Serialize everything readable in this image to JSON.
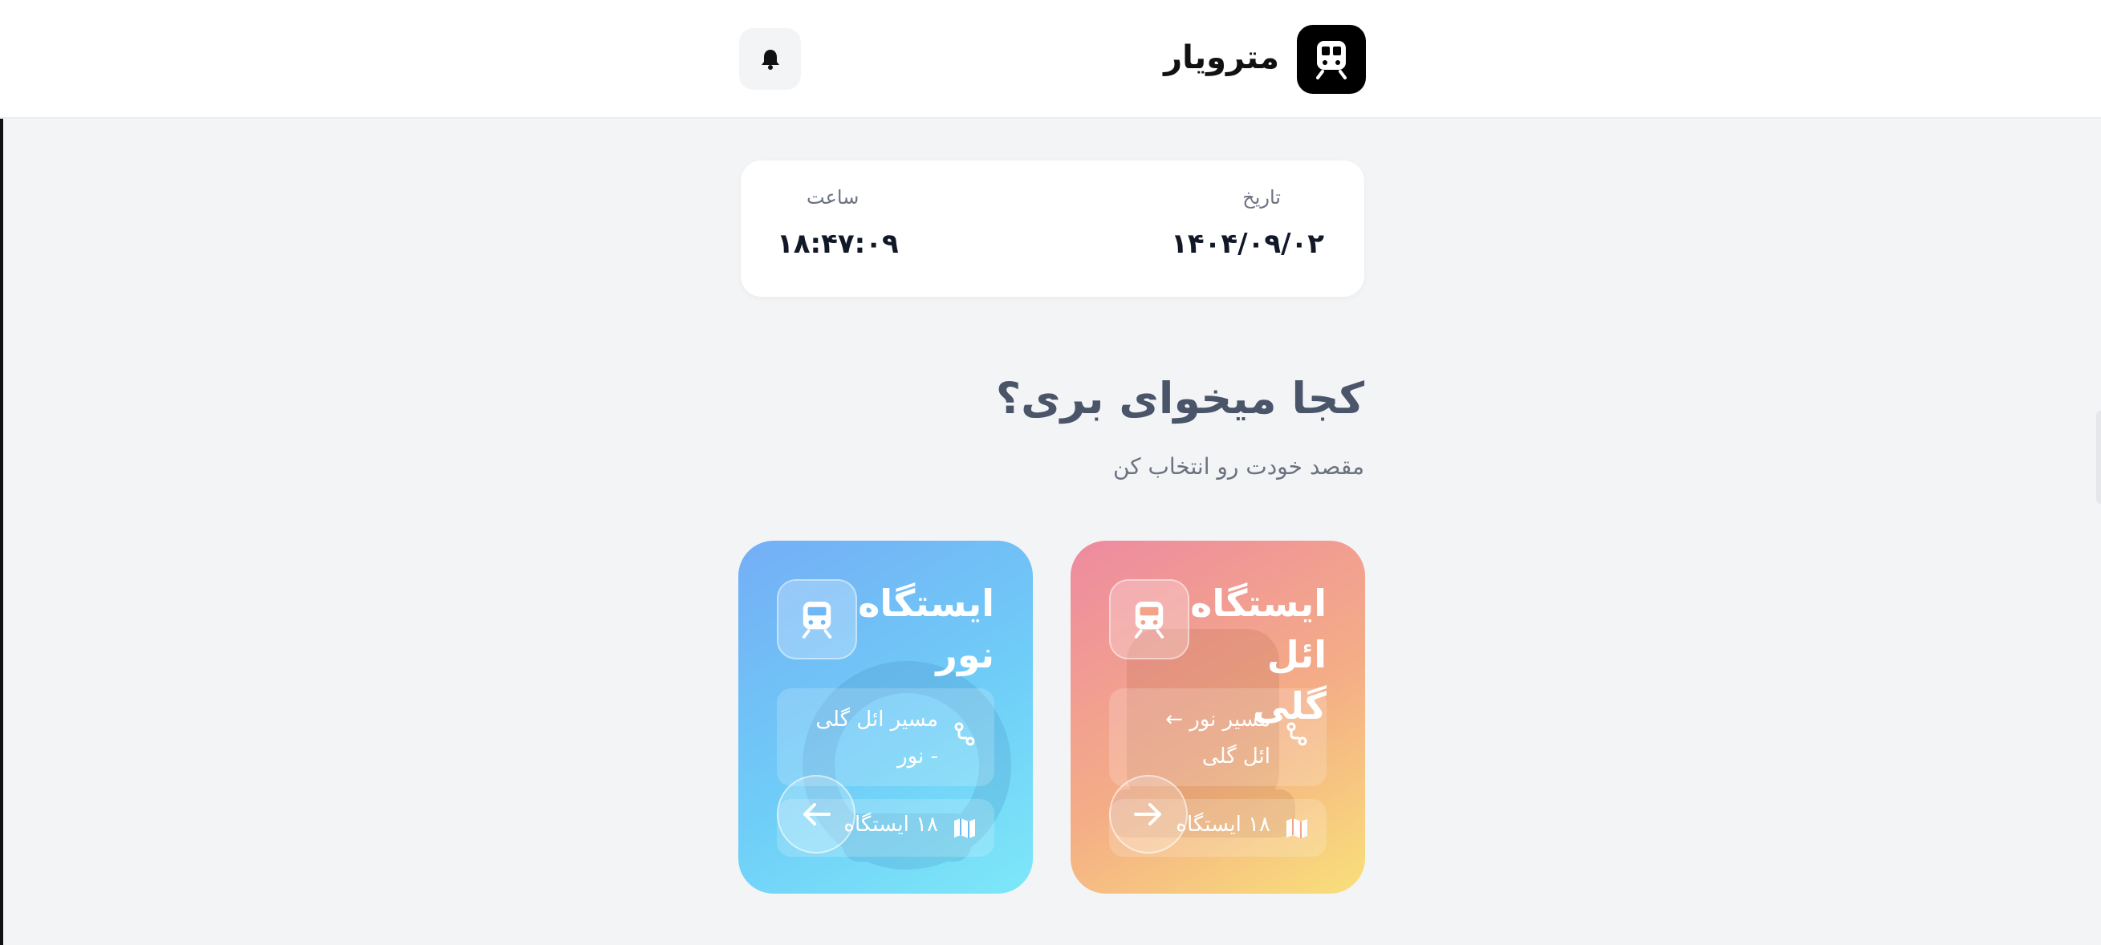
{
  "header": {
    "app_title": "مترویار",
    "logo_icon": "train-icon",
    "notification_icon": "bell-icon"
  },
  "datetime": {
    "date_label": "تاریخ",
    "date_value": "۱۴۰۴/۰۹/۰۲",
    "time_label": "ساعت",
    "time_value": "۱۸:۴۷:۰۹"
  },
  "main": {
    "heading": "کجا میخوای بری؟",
    "subheading": "مقصد خودت رو انتخاب کن"
  },
  "stations": [
    {
      "title": "ایستگاه ائل گلی",
      "route": "مسیر نور ← ائل گلی",
      "stops": "۱۸ ایستگاه",
      "color_from": "#ee8aa0",
      "color_to": "#f9e07a",
      "arrow_icon": "arrow-right-icon"
    },
    {
      "title": "ایستگاه نور",
      "route": "مسیر ائل گلی - نور",
      "stops": "۱۸ ایستگاه",
      "color_from": "#74aef6",
      "color_to": "#7de8f9",
      "arrow_icon": "arrow-left-icon"
    }
  ]
}
